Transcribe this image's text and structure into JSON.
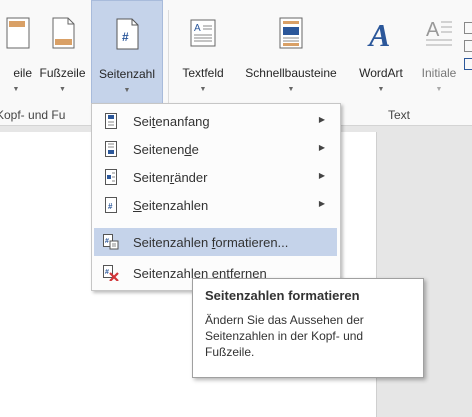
{
  "ribbon": {
    "buttons": [
      {
        "label": "eile",
        "icon": "header-icon"
      },
      {
        "label": "Fußzeile",
        "icon": "footer-icon"
      },
      {
        "label": "Seitenzahl",
        "icon": "page-number-icon"
      },
      {
        "label": "Textfeld",
        "icon": "textbox-icon"
      },
      {
        "label": "Schnellbausteine",
        "icon": "quick-parts-icon"
      },
      {
        "label": "WordArt",
        "icon": "wordart-icon"
      },
      {
        "label": "Initiale",
        "icon": "drop-cap-icon"
      }
    ],
    "groups": {
      "header_footer": "Kopf- und Fu",
      "text": "Text"
    }
  },
  "menu": {
    "items": [
      {
        "pre": "Sei",
        "key": "t",
        "post": "enanfang",
        "icon": "page-top-icon"
      },
      {
        "pre": "Seitenen",
        "key": "d",
        "post": "e",
        "icon": "page-bottom-icon"
      },
      {
        "pre": "Seiten",
        "key": "r",
        "post": "änder",
        "icon": "page-margins-icon"
      },
      {
        "pre": "",
        "key": "S",
        "post": "eitenzahlen",
        "icon": "current-position-icon"
      },
      {
        "pre": "Seitenzahlen ",
        "key": "f",
        "post": "ormatieren...",
        "icon": "format-page-numbers-icon"
      },
      {
        "pre": "Seitenzahlen entfernen",
        "key": "",
        "post": "",
        "icon": "remove-page-numbers-icon"
      }
    ]
  },
  "tooltip": {
    "title": "Seitenzahlen formatieren",
    "description": "Ändern Sie das Aussehen der Seitenzahlen in der Kopf- und Fußzeile."
  },
  "colors": {
    "highlight": "#c5d3ea",
    "accent_blue": "#2b579a",
    "remove_red": "#d13438"
  }
}
